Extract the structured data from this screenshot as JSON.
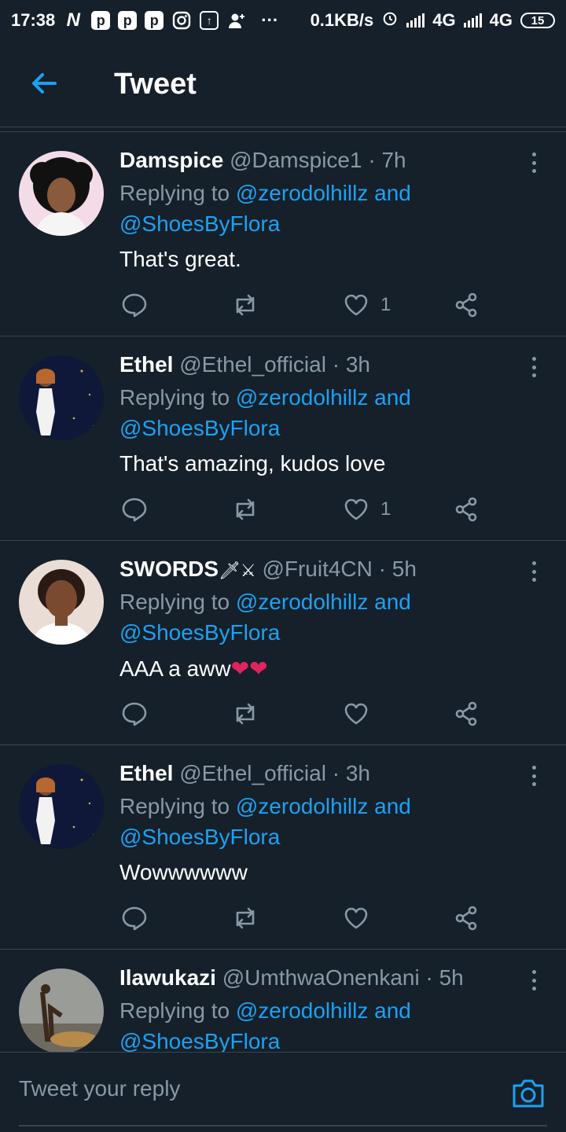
{
  "status_bar": {
    "time": "17:38",
    "app_icons": [
      "N",
      "p",
      "p",
      "p",
      "instagram-icon",
      "upload-icon",
      "person-add-icon"
    ],
    "dots": "···",
    "speed": "0.1KB/s",
    "network1": "4G",
    "network2": "4G",
    "battery": "15"
  },
  "header": {
    "title": "Tweet"
  },
  "colors": {
    "background": "#15202b",
    "accent": "#1da1f2",
    "muted": "#8899a6",
    "divider": "#38444d"
  },
  "tweets": [
    {
      "name": "Damspice",
      "handle": "@Damspice1",
      "dot": "·",
      "time": "7h",
      "replying_prefix": "Replying to",
      "mention1": "@zerodolhillz",
      "and": "and",
      "mention2": "@ShoesByFlora",
      "text": "That's great.",
      "likes": "1"
    },
    {
      "name": "Ethel",
      "handle": "@Ethel_official",
      "dot": "·",
      "time": "3h",
      "replying_prefix": "Replying to",
      "mention1": "@zerodolhillz",
      "and": "and",
      "mention2": "@ShoesByFlora",
      "text": "That's amazing, kudos love",
      "likes": "1"
    },
    {
      "name": "SWORDS",
      "name_emoji": "🗡⚔",
      "handle": "@Fruit4CN",
      "dot": "·",
      "time": "5h",
      "replying_prefix": "Replying to",
      "mention1": "@zerodolhillz",
      "and": "and",
      "mention2": "@ShoesByFlora",
      "text": "AAA a aww",
      "text_emoji": "❤❤",
      "likes": ""
    },
    {
      "name": "Ethel",
      "handle": "@Ethel_official",
      "dot": "·",
      "time": "3h",
      "replying_prefix": "Replying to",
      "mention1": "@zerodolhillz",
      "and": "and",
      "mention2": "@ShoesByFlora",
      "text": "Wowwwwww",
      "likes": ""
    },
    {
      "name": "Ilawukazi",
      "handle": "@UmthwaOnenkani",
      "dot": "·",
      "time": "5h",
      "replying_prefix": "Replying to",
      "mention1": "@zerodolhillz",
      "and": "and",
      "mention2": "@ShoesByFlora"
    }
  ],
  "reply_bar": {
    "placeholder": "Tweet your reply"
  }
}
